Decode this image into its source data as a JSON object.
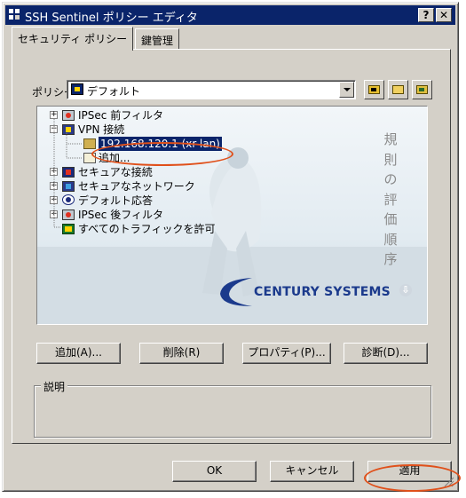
{
  "window": {
    "title": "SSH Sentinel ポリシー エディタ",
    "help_button": "?",
    "close_button": "✕"
  },
  "tabs": [
    {
      "label": "セキュリティ ポリシー",
      "active": true
    },
    {
      "label": "鍵管理",
      "active": false
    }
  ],
  "policy": {
    "label": "ポリシー:",
    "selected": "デフォルト"
  },
  "tree": {
    "items": [
      {
        "label": "IPSec 前フィルタ",
        "expander": "+"
      },
      {
        "label": "VPN 接続",
        "expander": "−"
      },
      {
        "label": "192.168.120.1 (xr-lan)",
        "selected": true
      },
      {
        "label": "追加..."
      },
      {
        "label": "セキュアな接続",
        "expander": "+"
      },
      {
        "label": "セキュアなネットワーク",
        "expander": "+"
      },
      {
        "label": "デフォルト応答",
        "expander": "+"
      },
      {
        "label": "IPSec 後フィルタ",
        "expander": "+"
      },
      {
        "label": "すべてのトラフィックを許可"
      }
    ],
    "side_text": [
      "規",
      "則",
      "の",
      "評",
      "価",
      "順",
      "序"
    ],
    "brand": "CENTURY SYSTEMS",
    "scroll_hint": "⇩"
  },
  "actions": {
    "add": "追加(A)...",
    "delete": "削除(R)",
    "properties": "プロパティ(P)...",
    "diagnose": "診断(D)..."
  },
  "description": {
    "label": "説明"
  },
  "footer": {
    "ok": "OK",
    "cancel": "キャンセル",
    "apply": "適用"
  },
  "colors": {
    "titlebar": "#0a246a",
    "face": "#d4d0c8",
    "annotation": "#e0501a",
    "selection": "#0a246a"
  }
}
